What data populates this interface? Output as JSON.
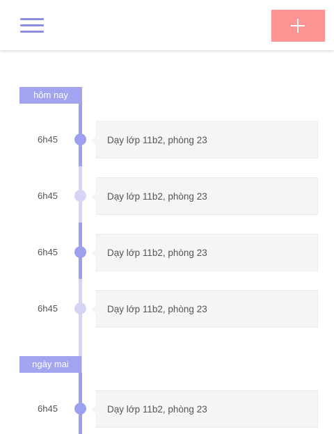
{
  "header": {
    "menu_icon": "hamburger-menu-icon",
    "add_icon": "plus-icon",
    "accent_color": "#8b8fe2",
    "add_button_color": "#ff9494"
  },
  "days": [
    {
      "label": "hôm nay",
      "items": [
        {
          "time": "6h45",
          "text": "Dạy lớp 11b2, phòng 23",
          "state": "active"
        },
        {
          "time": "6h45",
          "text": "Dạy lớp 11b2, phòng 23",
          "state": "inactive"
        },
        {
          "time": "6h45",
          "text": "Dạy lớp 11b2, phòng 23",
          "state": "active"
        },
        {
          "time": "6h45",
          "text": "Dạy lớp 11b2, phòng 23",
          "state": "inactive"
        }
      ]
    },
    {
      "label": "ngày mai",
      "items": [
        {
          "time": "6h45",
          "text": "Dạy lớp 11b2, phòng 23",
          "state": "active"
        }
      ]
    }
  ]
}
